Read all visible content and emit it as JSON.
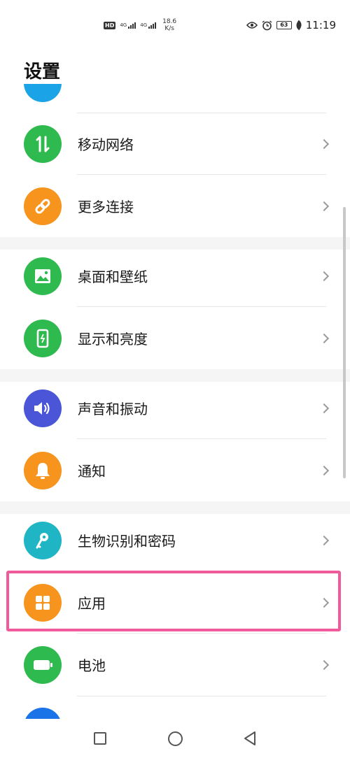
{
  "status_bar": {
    "hd": "HD",
    "network_1": "4G",
    "network_2": "4G",
    "speed_value": "18.6",
    "speed_unit": "K/s",
    "battery": "63",
    "time": "11:19"
  },
  "page_title": "设置",
  "items": [
    {
      "label": "移动网络",
      "icon": "mobile-data-icon",
      "color": "#2fba4f"
    },
    {
      "label": "更多连接",
      "icon": "link-icon",
      "color": "#f7941d"
    },
    {
      "label": "桌面和壁纸",
      "icon": "image-icon",
      "color": "#2fba4f"
    },
    {
      "label": "显示和亮度",
      "icon": "display-icon",
      "color": "#2fba4f"
    },
    {
      "label": "声音和振动",
      "icon": "volume-icon",
      "color": "#4a55d8"
    },
    {
      "label": "通知",
      "icon": "bell-icon",
      "color": "#f7941d"
    },
    {
      "label": "生物识别和密码",
      "icon": "key-icon",
      "color": "#1fb5c4"
    },
    {
      "label": "应用",
      "icon": "apps-icon",
      "color": "#f7941d"
    },
    {
      "label": "电池",
      "icon": "battery-icon",
      "color": "#2fba4f"
    }
  ],
  "highlight_color": "#f05a9a"
}
